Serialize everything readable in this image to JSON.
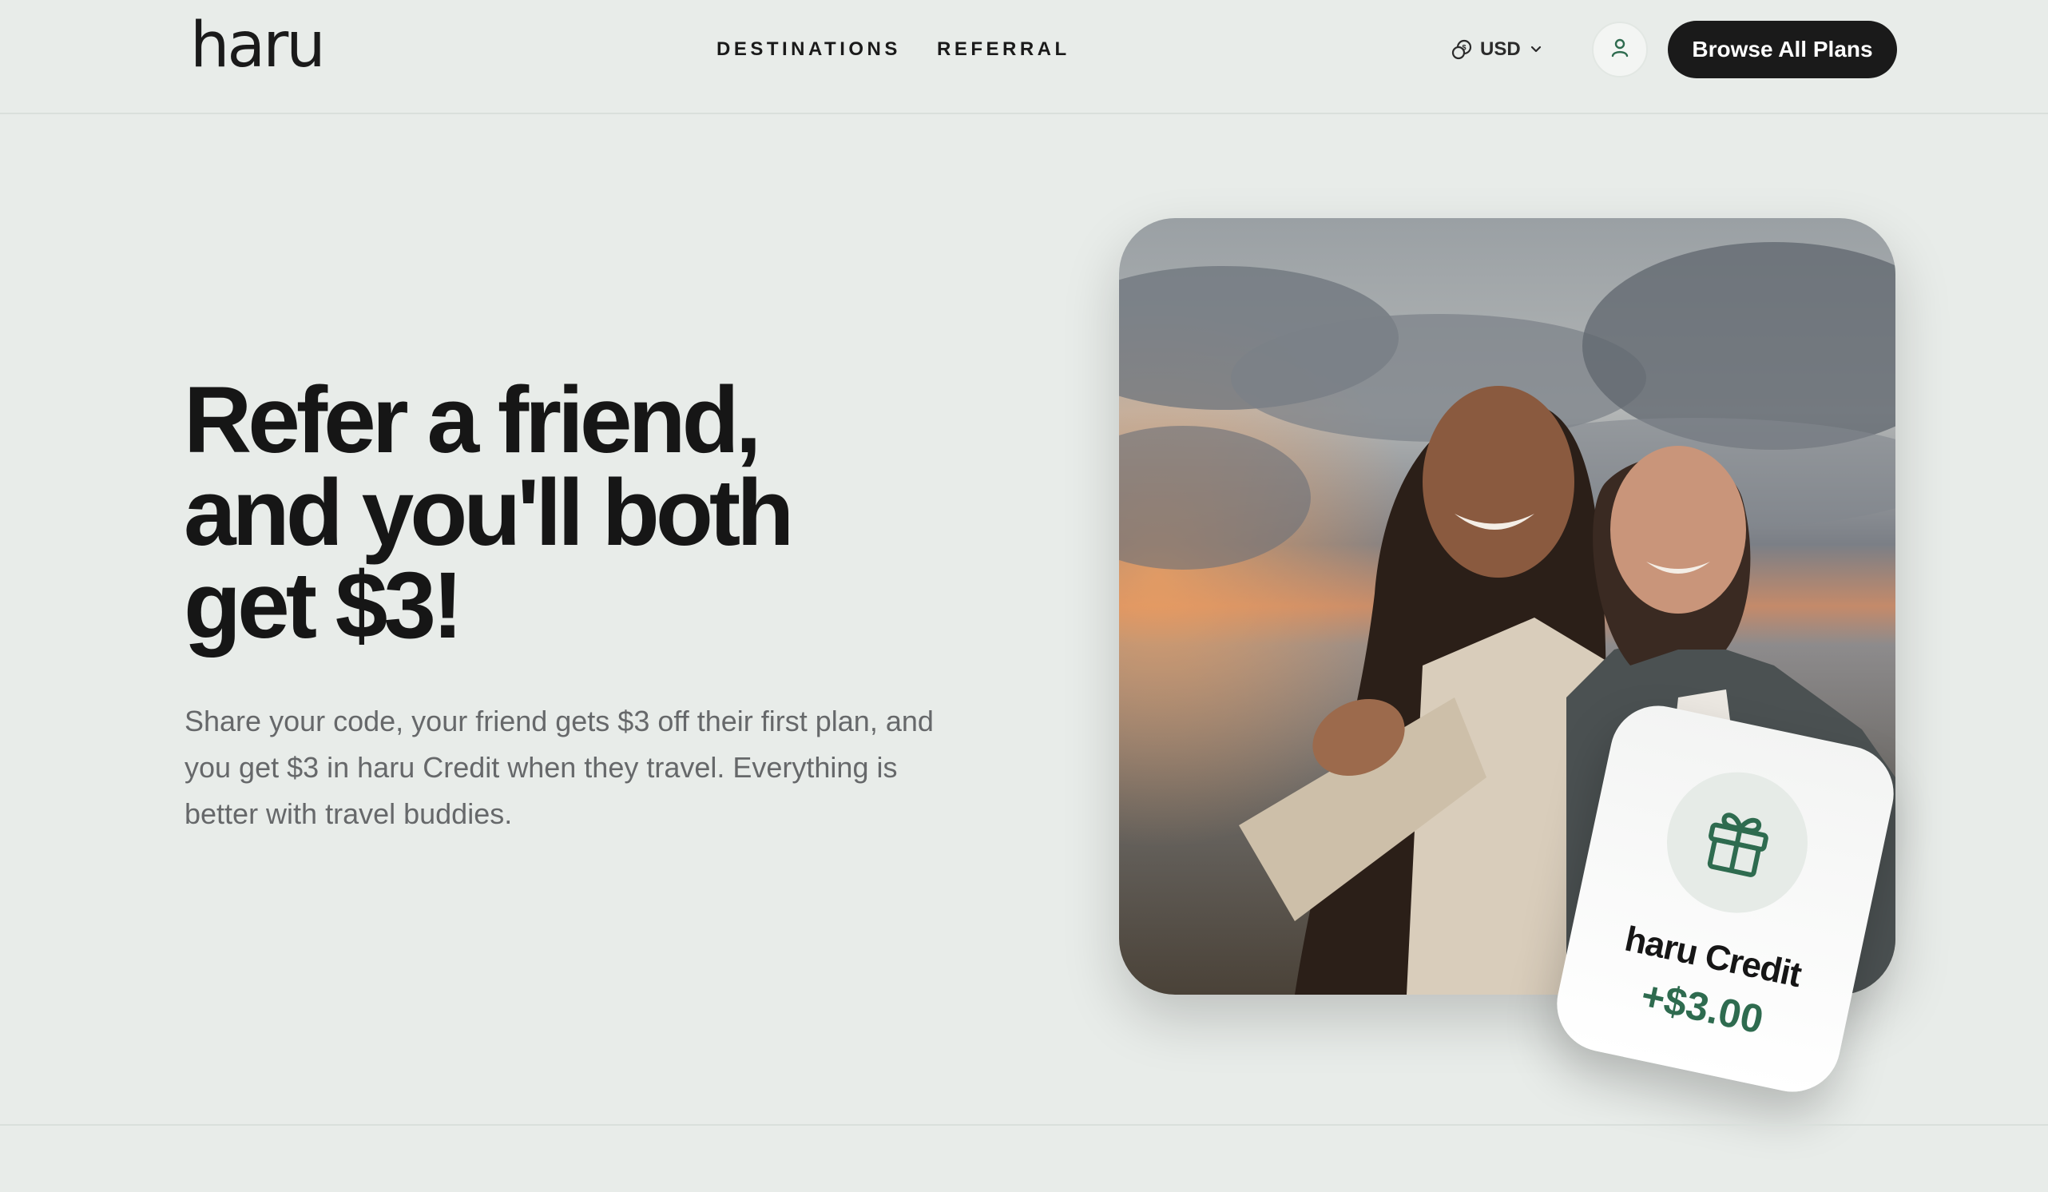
{
  "header": {
    "logo": "haru",
    "nav": [
      "DESTINATIONS",
      "REFERRAL"
    ],
    "currency": "USD",
    "cta_label": "Browse All Plans"
  },
  "hero": {
    "title": "Refer a friend, and you'll both get $3!",
    "description": "Share your code, your friend gets $3 off their first plan, and you get $3 in haru Credit when they travel. Everything is better with travel buddies."
  },
  "credit_card": {
    "label": "haru Credit",
    "amount": "+$3.00"
  },
  "colors": {
    "background": "#e8ece9",
    "dark": "#1a1a1a",
    "accent_green": "#2e6b4f",
    "muted_text": "#66686a"
  },
  "icons": {
    "currency": "currency-swap-icon",
    "dropdown": "chevron-down-icon",
    "account": "user-icon",
    "gift": "gift-icon"
  }
}
